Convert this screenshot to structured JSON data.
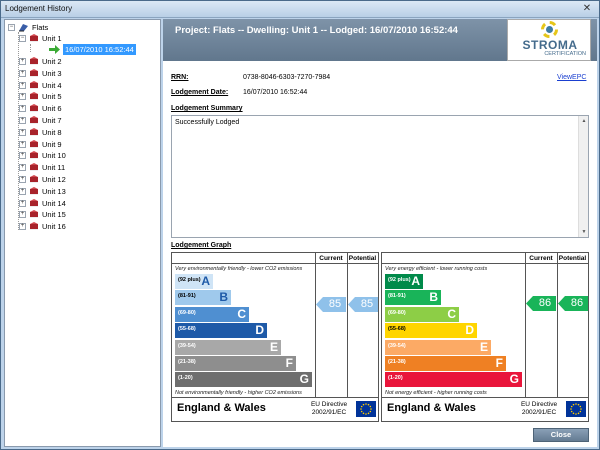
{
  "window": {
    "title": "Lodgement History",
    "close_glyph": "✕"
  },
  "tree": {
    "root_label": "Flats",
    "expanded_unit": "Unit 1",
    "selected_child": "16/07/2010 16:52:44",
    "units": [
      "Unit 2",
      "Unit 3",
      "Unit 4",
      "Unit 5",
      "Unit 6",
      "Unit 7",
      "Unit 8",
      "Unit 9",
      "Unit 10",
      "Unit 11",
      "Unit 12",
      "Unit 13",
      "Unit 14",
      "Unit 15",
      "Unit 16"
    ],
    "expand_glyph": "+",
    "collapse_glyph": "−"
  },
  "header": {
    "text": "Project: Flats -- Dwelling: Unit 1 -- Lodged: 16/07/2010 16:52:44"
  },
  "logo": {
    "name": "STROMA",
    "sub": "CERTIFICATION",
    "mark_colors": [
      "#e6c619",
      "#3d7ca3"
    ]
  },
  "rrn": {
    "label": "RRN:",
    "value": "0738-8046-6303-7270-7984"
  },
  "lodgement_date": {
    "label": "Lodgement Date:",
    "value": "16/07/2010 16:52:44"
  },
  "view_epc": "ViewEPC",
  "summary": {
    "heading": "Lodgement Summary",
    "text": "Successfully Lodged"
  },
  "graph": {
    "heading": "Lodgement Graph",
    "current_label": "Current",
    "potential_label": "Potential",
    "footer": {
      "region": "England & Wales",
      "directive": "EU Directive 2002/91/EC"
    },
    "environmental": {
      "top_note": "Very environmentally friendly - lower CO2 emissions",
      "bottom_note": "Not environmentally friendly - higher CO2 emissions",
      "bands": [
        {
          "range": "(92 plus)",
          "letter": "A",
          "color": "#cfe4f6"
        },
        {
          "range": "(81-91)",
          "letter": "B",
          "color": "#9fc9ec"
        },
        {
          "range": "(69-80)",
          "letter": "C",
          "color": "#4f8fd1"
        },
        {
          "range": "(55-68)",
          "letter": "D",
          "color": "#1e5aa8"
        },
        {
          "range": "(39-54)",
          "letter": "E",
          "color": "#a8a8a8"
        },
        {
          "range": "(21-38)",
          "letter": "F",
          "color": "#8e8e8e"
        },
        {
          "range": "(1-20)",
          "letter": "G",
          "color": "#6e6e6e"
        }
      ],
      "current": 85,
      "potential": 85,
      "arrow_color": "#8fc1ea"
    },
    "energy": {
      "top_note": "Very energy efficient - lower running costs",
      "bottom_note": "Not energy efficient - higher running costs",
      "bands": [
        {
          "range": "(92 plus)",
          "letter": "A",
          "color": "#008a4a"
        },
        {
          "range": "(81-91)",
          "letter": "B",
          "color": "#19b459"
        },
        {
          "range": "(69-80)",
          "letter": "C",
          "color": "#8dce46"
        },
        {
          "range": "(55-68)",
          "letter": "D",
          "color": "#ffd500"
        },
        {
          "range": "(39-54)",
          "letter": "E",
          "color": "#fcaa65"
        },
        {
          "range": "(21-38)",
          "letter": "F",
          "color": "#ef8023"
        },
        {
          "range": "(1-20)",
          "letter": "G",
          "color": "#e9153b"
        }
      ],
      "current": 86,
      "potential": 86,
      "arrow_color": "#19b459"
    }
  },
  "close_button": "Close"
}
